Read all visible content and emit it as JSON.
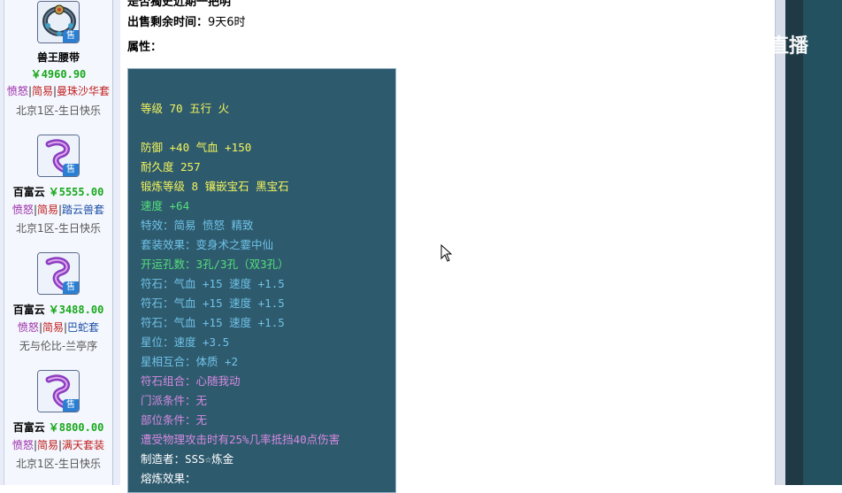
{
  "sidebar": {
    "items": [
      {
        "name": "兽王腰带",
        "price": "￥4960.90",
        "tags": [
          "愤怒",
          "简易",
          "曼珠沙华套"
        ],
        "server": "北京1区-生日快乐",
        "badge": "售"
      },
      {
        "name": "百富云",
        "price": "￥5555.00",
        "tags": [
          "愤怒",
          "简易",
          "踏云兽套"
        ],
        "server": "北京1区-生日快乐",
        "badge": "售"
      },
      {
        "name": "百富云",
        "price": "￥3488.00",
        "tags": [
          "愤怒",
          "简易",
          "巴蛇套"
        ],
        "server": "无与伦比-兰亭序",
        "badge": "售"
      },
      {
        "name": "百富云",
        "price": "￥8800.00",
        "tags": [
          "愤怒",
          "简易",
          "满天套装"
        ],
        "server": "北京1区-生日快乐",
        "badge": "售"
      }
    ],
    "tag_separator": "|"
  },
  "main": {
    "top_cut_text": "是否獨史近期一把明",
    "sale_time_label": "出售剩余时间：",
    "sale_time_value": "9天6时",
    "attributes_label": "属性：",
    "attr_lines": [
      {
        "text": "等级 70 五行 火",
        "color": "yellow"
      },
      {
        "text": "防御 +40 气血 +150",
        "color": "yellow"
      },
      {
        "text": "耐久度 257",
        "color": "yellow"
      },
      {
        "text": "锻炼等级 8 镶嵌宝石 黑宝石",
        "color": "yellow"
      },
      {
        "text": "速度 +64",
        "color": "green"
      },
      {
        "text": "特效：简易 愤怒 精致",
        "color": "blue"
      },
      {
        "text": "套装效果：变身术之霎中仙",
        "color": "blue"
      },
      {
        "text": "开运孔数：3孔/3孔（双3孔）",
        "color": "green"
      },
      {
        "text": "符石：气血 +15 速度 +1.5",
        "color": "blue"
      },
      {
        "text": "符石：气血 +15 速度 +1.5",
        "color": "blue"
      },
      {
        "text": "符石：气血 +15 速度 +1.5",
        "color": "blue"
      },
      {
        "text": "星位：速度 +3.5",
        "color": "blue"
      },
      {
        "text": "星相互合：体质 +2",
        "color": "blue"
      },
      {
        "text": "符石组合：心随我动",
        "color": "purple"
      },
      {
        "text": "门派条件：无",
        "color": "purple"
      },
      {
        "text": "部位条件：无",
        "color": "purple"
      },
      {
        "text": "遭受物理攻击时有25%几率抵挡40点伤害",
        "color": "purple"
      },
      {
        "text": "制造者：SSS☆炼金",
        "color": "white"
      },
      {
        "text": "熔炼效果：",
        "color": "white"
      }
    ]
  },
  "watermark": {
    "text": "CC直播"
  },
  "colors": {
    "price_green": "#17a81a",
    "attr_bg": "#2e5a6e",
    "yellow": "#f3f55a",
    "blue": "#6fc2e6",
    "green": "#54e07a",
    "purple": "#d68ae0",
    "white": "#ffffff"
  }
}
